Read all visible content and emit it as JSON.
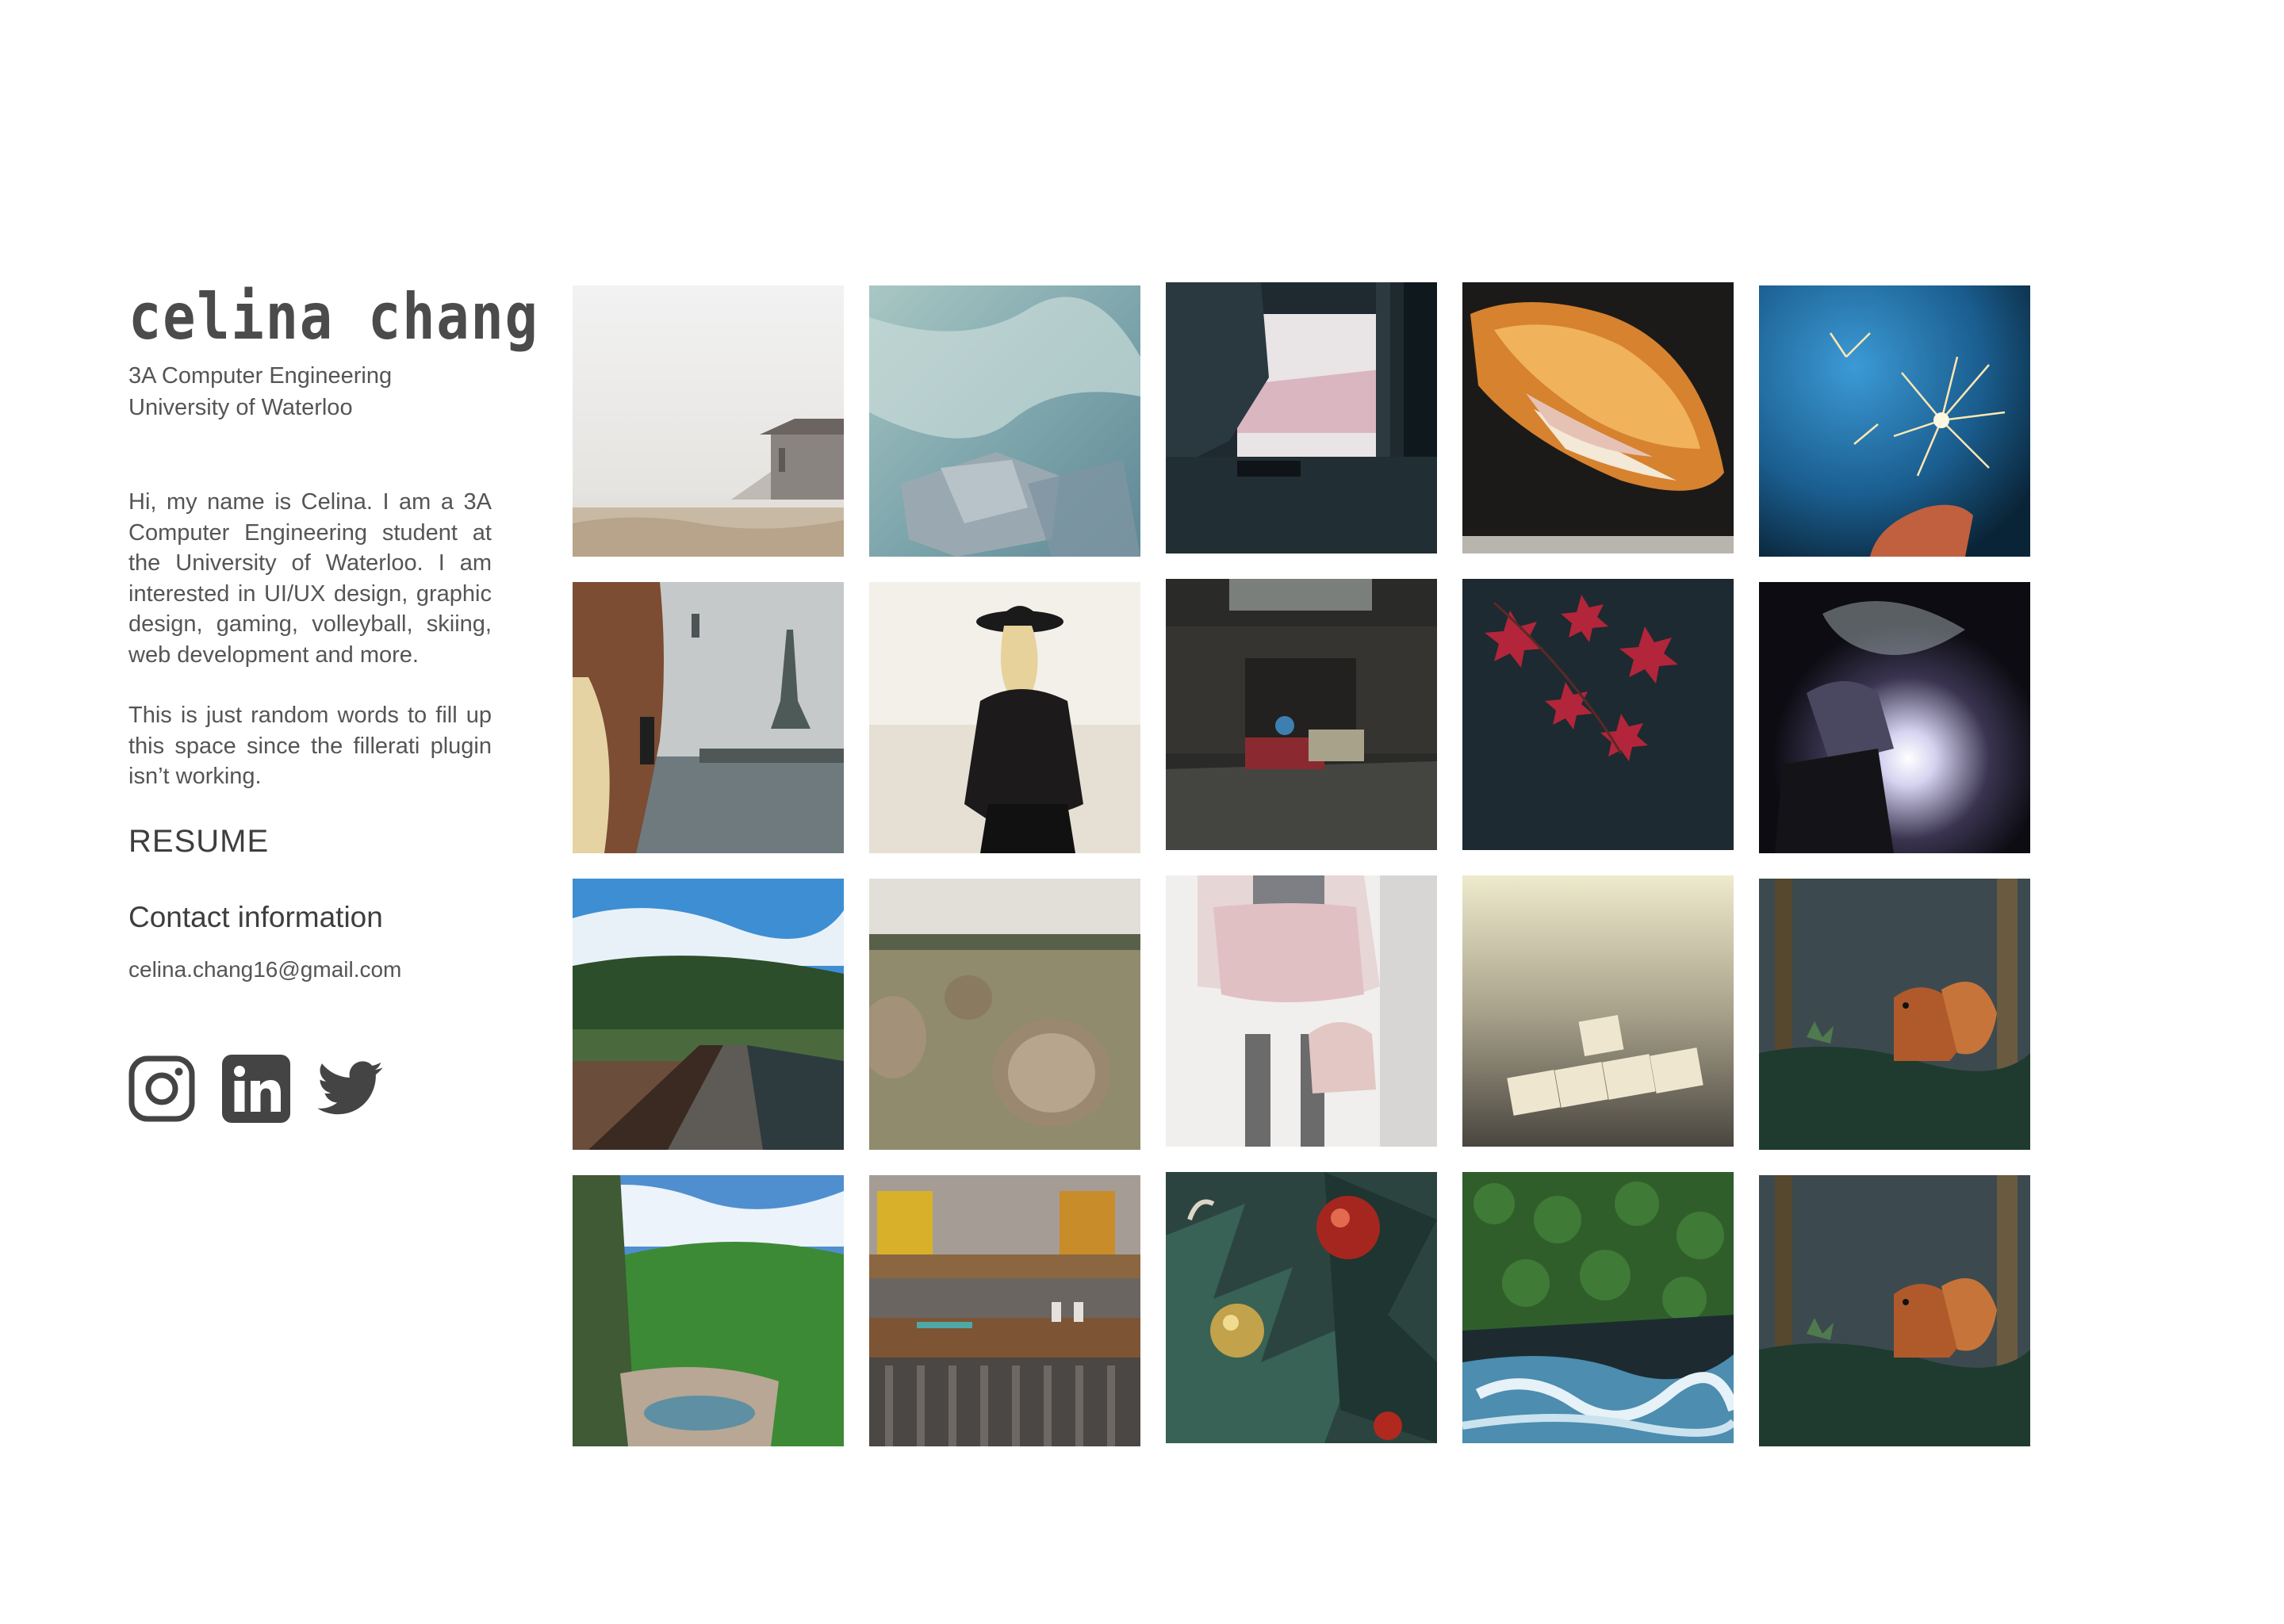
{
  "profile": {
    "name": "celina chang",
    "program": "3A Computer Engineering",
    "school": "University of Waterloo"
  },
  "bio": {
    "paragraph_1": "Hi, my name is Celina. I am a 3A Computer Engineering student at the University of Waterloo. I am interested in UI/UX design, graphic design, gaming, volleyball, skiing, web development and more.",
    "paragraph_2": "This is just random words to fill up this space since the fillerati plugin isn’t working."
  },
  "links": {
    "resume": "RESUME",
    "contact_heading": "Contact information",
    "email": "celina.chang16@gmail.com"
  },
  "social": [
    {
      "icon": "instagram-icon"
    },
    {
      "icon": "linkedin-icon"
    },
    {
      "icon": "twitter-icon"
    }
  ],
  "colors": {
    "text": "#4a4a4a",
    "icon": "#444444",
    "background": "#ffffff"
  },
  "gallery": [
    {
      "subject": "foggy barn field"
    },
    {
      "subject": "glacier ice water"
    },
    {
      "subject": "dark window curtain"
    },
    {
      "subject": "baguette sandwich"
    },
    {
      "subject": "sparkler on blue"
    },
    {
      "subject": "statue of liberty photo"
    },
    {
      "subject": "woman in black hat"
    },
    {
      "subject": "abandoned dark hall"
    },
    {
      "subject": "red maple leaves"
    },
    {
      "subject": "welder sparks"
    },
    {
      "subject": "railway tracks town"
    },
    {
      "subject": "hay bales field"
    },
    {
      "subject": "pink skirt handbag"
    },
    {
      "subject": "scrabble tiles"
    },
    {
      "subject": "red squirrel forest"
    },
    {
      "subject": "green canyon lake"
    },
    {
      "subject": "wooden cafe table"
    },
    {
      "subject": "christmas tree ornaments"
    },
    {
      "subject": "forest and river aerial"
    },
    {
      "subject": "red squirrel forest"
    }
  ]
}
